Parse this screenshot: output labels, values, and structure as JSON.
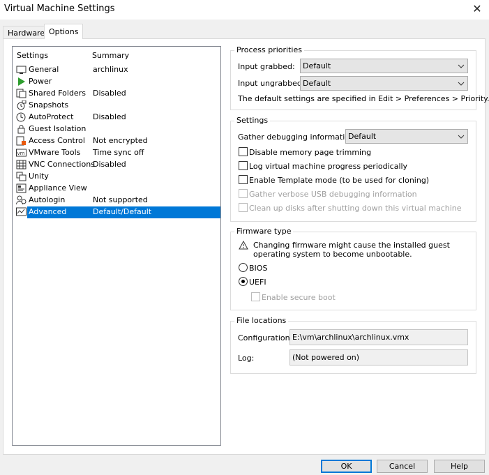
{
  "window": {
    "title": "Virtual Machine Settings"
  },
  "tabs": [
    "Hardware",
    "Options"
  ],
  "list": {
    "col_settings": "Settings",
    "col_summary": "Summary",
    "items": [
      {
        "name": "General",
        "summary": "archlinux",
        "icon": "monitor-icon"
      },
      {
        "name": "Power",
        "summary": "",
        "icon": "play-icon"
      },
      {
        "name": "Shared Folders",
        "summary": "Disabled",
        "icon": "folder-share-icon"
      },
      {
        "name": "Snapshots",
        "summary": "",
        "icon": "snapshot-icon"
      },
      {
        "name": "AutoProtect",
        "summary": "Disabled",
        "icon": "clock-icon"
      },
      {
        "name": "Guest Isolation",
        "summary": "",
        "icon": "lock-icon"
      },
      {
        "name": "Access Control",
        "summary": "Not encrypted",
        "icon": "access-control-icon"
      },
      {
        "name": "VMware Tools",
        "summary": "Time sync off",
        "icon": "vm-icon"
      },
      {
        "name": "VNC Connections",
        "summary": "Disabled",
        "icon": "vnc-icon"
      },
      {
        "name": "Unity",
        "summary": "",
        "icon": "unity-icon"
      },
      {
        "name": "Appliance View",
        "summary": "",
        "icon": "appliance-icon"
      },
      {
        "name": "Autologin",
        "summary": "Not supported",
        "icon": "autologin-icon"
      },
      {
        "name": "Advanced",
        "summary": "Default/Default",
        "icon": "advanced-icon"
      }
    ]
  },
  "process_priorities": {
    "title": "Process priorities",
    "input_grabbed_label": "Input grabbed:",
    "input_grabbed_value": "Default",
    "input_ungrabbed_label": "Input ungrabbed:",
    "input_ungrabbed_value": "Default",
    "note": "The default settings are specified in Edit > Preferences > Priority."
  },
  "settings": {
    "title": "Settings",
    "gather_label": "Gather debugging information:",
    "gather_value": "Default",
    "disable_trimming": "Disable memory page trimming",
    "log_progress": "Log virtual machine progress periodically",
    "template_mode": "Enable Template mode (to be used for cloning)",
    "usb_debug": "Gather verbose USB debugging information",
    "clean_disks": "Clean up disks after shutting down this virtual machine"
  },
  "firmware": {
    "title": "Firmware type",
    "warning_line1": "Changing firmware might cause the installed guest",
    "warning_line2": "operating system to become unbootable.",
    "bios": "BIOS",
    "uefi": "UEFI",
    "secure_boot": "Enable secure boot"
  },
  "files": {
    "title": "File locations",
    "config_label": "Configuration:",
    "config_value": "E:\\vm\\archlinux\\archlinux.vmx",
    "log_label": "Log:",
    "log_value": "(Not powered on)"
  },
  "buttons": {
    "ok": "OK",
    "cancel": "Cancel",
    "help": "Help"
  },
  "colors": {
    "selection": "#0078d7",
    "power": "#2e9e2e"
  }
}
